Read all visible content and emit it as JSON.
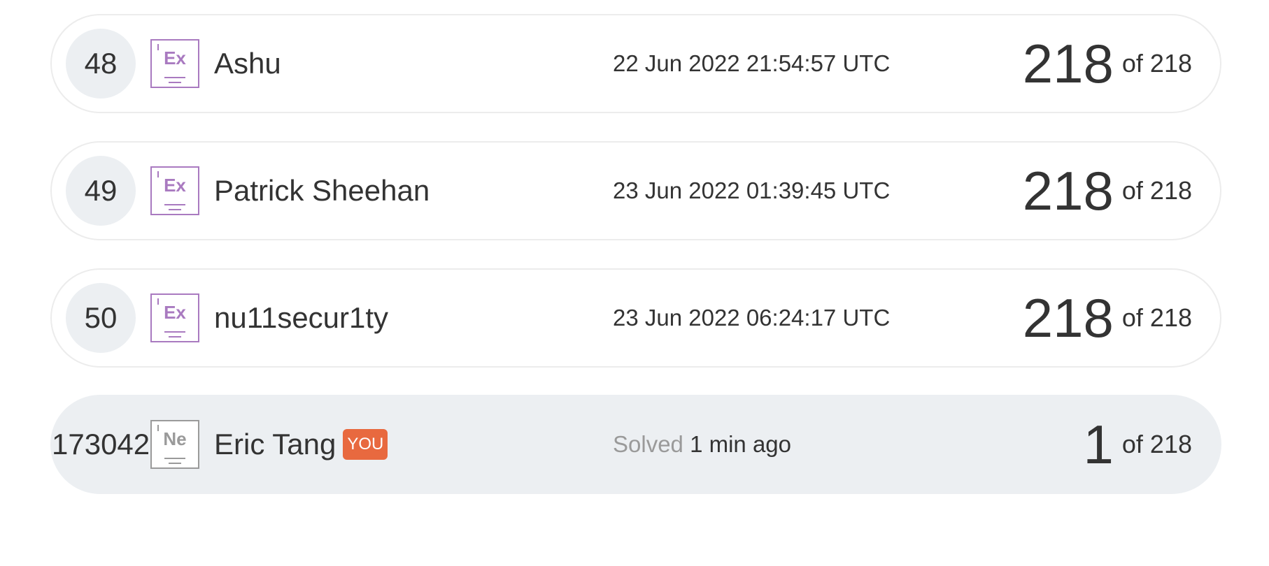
{
  "leaderboard": {
    "rows": [
      {
        "rank": "48",
        "badge_symbol": "Ex",
        "badge_icon": "element-ex-icon",
        "name": "Ashu",
        "time": "22 Jun 2022 21:54:57 UTC",
        "score": "218",
        "total": "of 218"
      },
      {
        "rank": "49",
        "badge_symbol": "Ex",
        "badge_icon": "element-ex-icon",
        "name": "Patrick Sheehan",
        "time": "23 Jun 2022 01:39:45 UTC",
        "score": "218",
        "total": "of 218"
      },
      {
        "rank": "50",
        "badge_symbol": "Ex",
        "badge_icon": "element-ex-icon",
        "name": "nu11secur1ty",
        "time": "23 Jun 2022 06:24:17 UTC",
        "score": "218",
        "total": "of 218"
      }
    ],
    "current_user": {
      "rank": "173042",
      "badge_symbol": "Ne",
      "badge_icon": "element-ne-icon",
      "name": "Eric Tang",
      "you_label": "YOU",
      "solved_label": "Solved",
      "solved_time": "1 min ago",
      "score": "1",
      "total": "of 218"
    }
  },
  "colors": {
    "badge_ex": "#a97ac0",
    "badge_ne": "#9a9a9a",
    "you_badge": "#e8693f",
    "current_row_bg": "#eceff2"
  }
}
